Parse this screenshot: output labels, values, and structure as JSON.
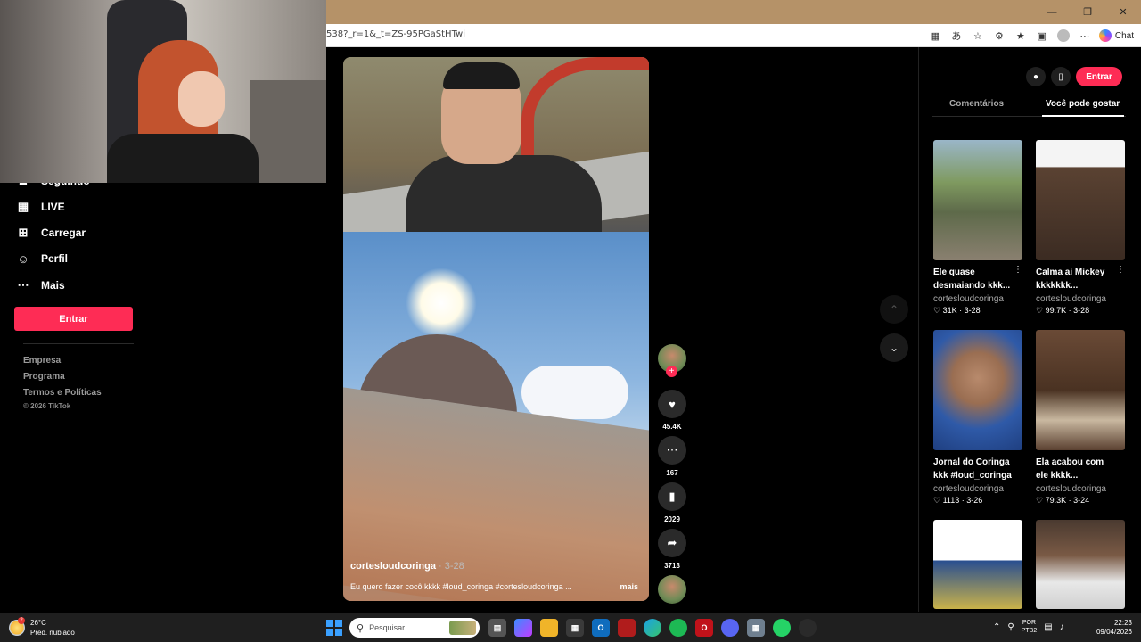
{
  "browser": {
    "url": "538?_r=1&_t=ZS-95PGaStHTwi",
    "chat_label": "Chat"
  },
  "sidebar": {
    "items": [
      {
        "label": "Seguindo",
        "icon": "following-icon"
      },
      {
        "label": "LIVE",
        "icon": "live-icon"
      },
      {
        "label": "Carregar",
        "icon": "upload-icon"
      },
      {
        "label": "Perfil",
        "icon": "profile-icon"
      },
      {
        "label": "Mais",
        "icon": "more-icon"
      }
    ],
    "enter_label": "Entrar",
    "footer": [
      "Empresa",
      "Programa",
      "Termos e Políticas"
    ],
    "copyright": "© 2026 TikTok"
  },
  "video": {
    "username": "cortesloudcoringa",
    "date": " · 3-28",
    "caption": "Eu quero fazer cocô kkkk #loud_coringa #cortesloudcoringa ...",
    "more": "mais"
  },
  "actions": {
    "likes": "45.4K",
    "comments": "167",
    "saves": "2029",
    "shares": "3713"
  },
  "right_panel": {
    "enter_label": "Entrar",
    "tabs": [
      "Comentários",
      "Você pode gostar"
    ],
    "cards": [
      {
        "title": "Ele quase desmaiando kkk...",
        "user": "cortesloudcoringa",
        "likes": "31K",
        "date": "3-28"
      },
      {
        "title": "Calma ai Mickey kkkkkkk...",
        "user": "cortesloudcoringa",
        "likes": "99.7K",
        "date": "3-28"
      },
      {
        "title": "Jornal do Coringa kkk #loud_coringa",
        "user": "cortesloudcoringa",
        "likes": "1113",
        "date": "3-26"
      },
      {
        "title": "Ela acabou com ele kkkk...",
        "user": "cortesloudcoringa",
        "likes": "79.3K",
        "date": "3-24"
      }
    ]
  },
  "taskbar": {
    "temperature": "26°C",
    "weather": "Pred. nublado",
    "weather_badge": "2",
    "search_placeholder": "Pesquisar",
    "lang_top": "POR",
    "lang_bottom": "PTB2",
    "time": "22:23",
    "date": "09/04/2026"
  }
}
